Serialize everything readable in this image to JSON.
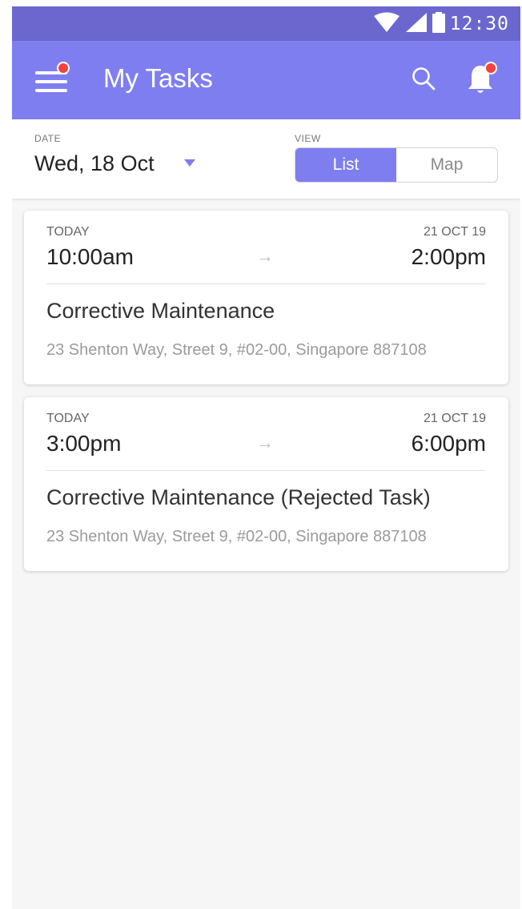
{
  "status": {
    "time": "12:30",
    "icons": [
      "wifi-icon",
      "signal-icon",
      "battery-icon"
    ]
  },
  "appbar": {
    "title": "My Tasks",
    "icons": [
      "menu-icon",
      "search-icon",
      "bell-icon"
    ],
    "color": "#7f7ef0",
    "badge_color": "#f2433a"
  },
  "filters": {
    "date_label": "DATE",
    "date_value": "Wed, 18 Oct",
    "view_label": "VIEW",
    "view_options": [
      "List",
      "Map"
    ],
    "selected_view": "List"
  },
  "tasks": [
    {
      "day": "TODAY",
      "end_date": "21 OCT 19",
      "start_time": "10:00am",
      "end_time": "2:00pm",
      "arrow": "→",
      "title": "Corrective Maintenance",
      "address": "23 Shenton Way, Street 9, #02-00, Singapore 887108"
    },
    {
      "day": "TODAY",
      "end_date": "21 OCT 19",
      "start_time": "3:00pm",
      "end_time": "6:00pm",
      "arrow": "→",
      "title": "Corrective Maintenance (Rejected Task)",
      "address": "23 Shenton Way, Street 9, #02-00, Singapore 887108"
    }
  ]
}
